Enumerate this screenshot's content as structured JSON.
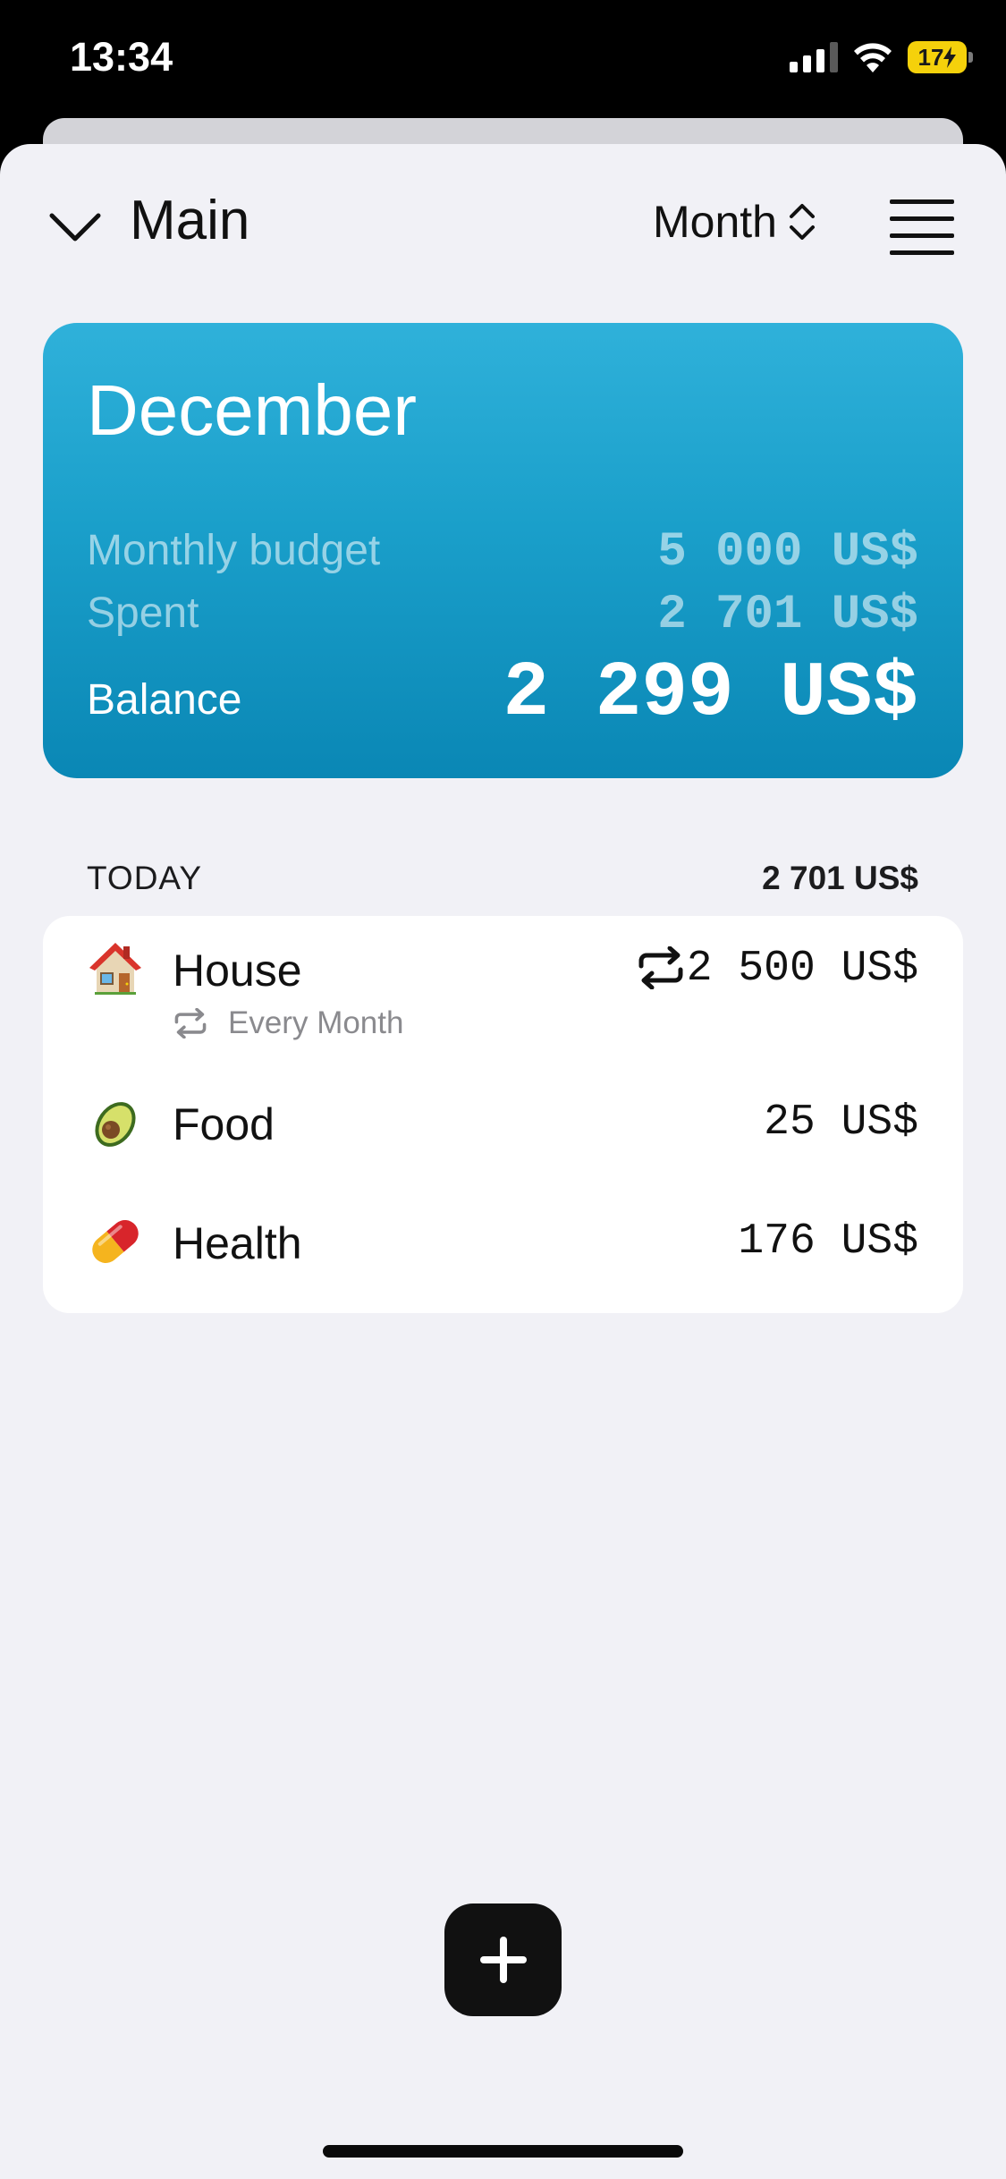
{
  "status_bar": {
    "time": "13:34",
    "battery": "17"
  },
  "header": {
    "title": "Main",
    "period_label": "Month"
  },
  "summary": {
    "month": "December",
    "budget_label": "Monthly budget",
    "budget_value": "5 000 US$",
    "spent_label": "Spent",
    "spent_value": "2 701 US$",
    "balance_label": "Balance",
    "balance_value": "2 299 US$"
  },
  "section": {
    "title": "TODAY",
    "total": "2 701 US$"
  },
  "transactions": [
    {
      "icon": "house-emoji-icon",
      "name": "House",
      "amount": "2 500 US$",
      "recurring": true,
      "recurrence_label": "Every Month"
    },
    {
      "icon": "avocado-emoji-icon",
      "name": "Food",
      "amount": "25 US$"
    },
    {
      "icon": "pill-emoji-icon",
      "name": "Health",
      "amount": "176 US$"
    }
  ],
  "colors": {
    "card_gradient_top": "#2fb1da",
    "card_gradient_bottom": "#0a87b5",
    "sheet_background": "#f1f1f6",
    "battery_low_power": "#f5d10b"
  }
}
